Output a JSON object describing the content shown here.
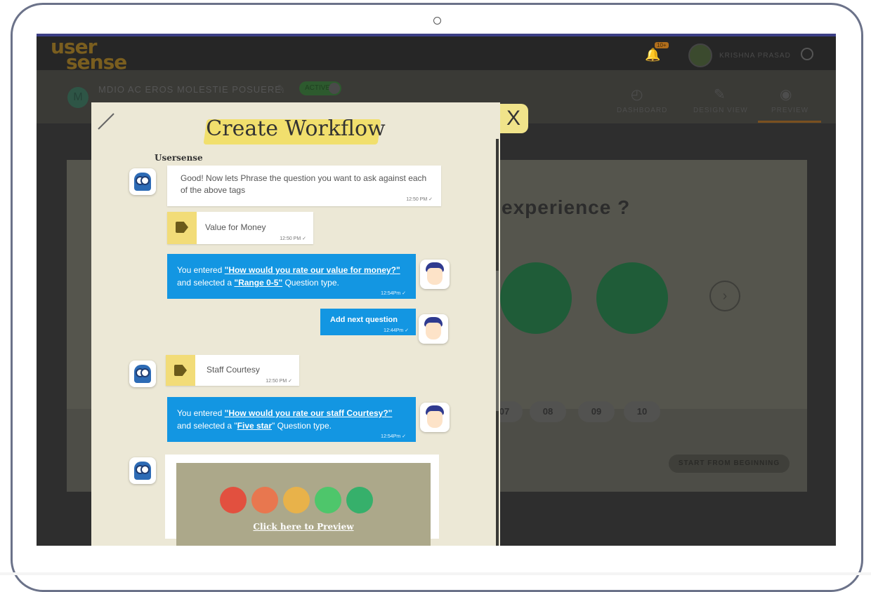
{
  "app": {
    "logo_line1": "user",
    "logo_line2": "sense",
    "notification_badge": "10+",
    "username": "KRISHNA PRASAD"
  },
  "project": {
    "initial": "M",
    "title": "MDIO AC EROS MOLESTIE POSUERE.",
    "status_toggle": "ACTIVE"
  },
  "nav": {
    "tabs": [
      {
        "label": "DASHBOARD",
        "icon": "dashboard-icon"
      },
      {
        "label": "DESIGN VIEW",
        "icon": "edit-icon"
      },
      {
        "label": "PREVIEW",
        "icon": "eye-icon",
        "active": true
      }
    ]
  },
  "preview_bg": {
    "question_fragment": "experience ?",
    "scale_numbers": [
      "07",
      "08",
      "09",
      "10"
    ],
    "restart_label": "START FROM BEGINNING"
  },
  "modal": {
    "title": "Create Workflow",
    "close_label": "X",
    "sender": "Usersense",
    "messages": [
      {
        "type": "bot-text",
        "text": "Good! Now lets Phrase the question you want to ask against each of the above tags",
        "time": "12:50 PM"
      },
      {
        "type": "tag",
        "text": "Value for Money",
        "time": "12:50 PM"
      },
      {
        "type": "user",
        "prefix": "You entered ",
        "question": "\"How would you rate our value for money?\"",
        "mid": "and selected a ",
        "qtype": "\"Range 0-5\"",
        "suffix": " Question type.",
        "time": "12:54Pm"
      },
      {
        "type": "user-action",
        "text": "Add next question",
        "time": "12:44Pm"
      },
      {
        "type": "tag",
        "text": "Staff Courtesy",
        "time": "12:50 PM"
      },
      {
        "type": "user",
        "prefix": "You entered ",
        "question": "\"How would you rate our staff Courtesy?\"",
        "mid": "and selected a \"",
        "qtype": "Five star",
        "suffix": "\" Question type.",
        "time": "12:54Pm"
      }
    ],
    "preview_link": "Click here to Preview",
    "emoji_colors": [
      "#e2503f",
      "#e8774f",
      "#e8b24a",
      "#4ec66b",
      "#36b06b"
    ]
  }
}
